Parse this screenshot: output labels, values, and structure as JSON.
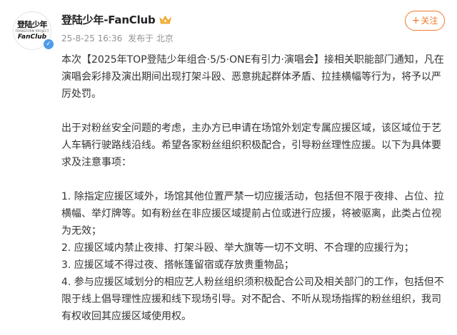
{
  "post": {
    "author": {
      "name": "登陆少年-FanClub",
      "avatar_text_top": "登陆少年",
      "avatar_text_mid": "TRANSFORM PROJECT",
      "avatar_text_bottom": "FanClub"
    },
    "meta": {
      "time": "25-8-25 16:36",
      "location": "发布于 北京"
    },
    "follow_label": "关注",
    "paragraphs": [
      "本次【2025年TOP登陆少年组合·5/5·ONE有引力·演唱会】接相关职能部门通知，凡在演唱会彩排及演出期间出现打架斗殴、恶意挑起群体矛盾、拉挂横幅等行为，将予以严厉处罚。",
      "出于对粉丝安全问题的考虑，主办方已申请在场馆外划定专属应援区域，该区域位于艺人车辆行驶路线沿线。希望各家粉丝组织积极配合，引导粉丝理性应援。以下为具体要求及注意事项：",
      "1. 除指定应援区域外，场馆其他位置严禁一切应援活动，包括但不限于夜排、占位、拉横幅、举灯牌等。如有粉丝在非应援区域提前占位或进行应援，将被驱离，此类占位视为无效；",
      "2. 应援区域内禁止夜排、打架斗殴、举大旗等一切不文明、不合理的应援行为；",
      "3. 应援区域不得过夜、搭帐篷留宿或存放贵重物品；",
      "4. 参与应援区域划分的相应艺人粉丝组织须积极配合公司及相关部门的工作，包括但不限于线上倡导理性应援和线下现场引导。对不配合、不听从现场指挥的粉丝组织，我司有权收回其应援区域使用权。"
    ]
  },
  "colors": {
    "accent": "#f27a2d",
    "meta": "#939393",
    "verified": "#4d9ce8"
  },
  "icons": {
    "verified": "verified-badge-icon",
    "crown": "crown-icon",
    "plus": "plus-icon"
  }
}
